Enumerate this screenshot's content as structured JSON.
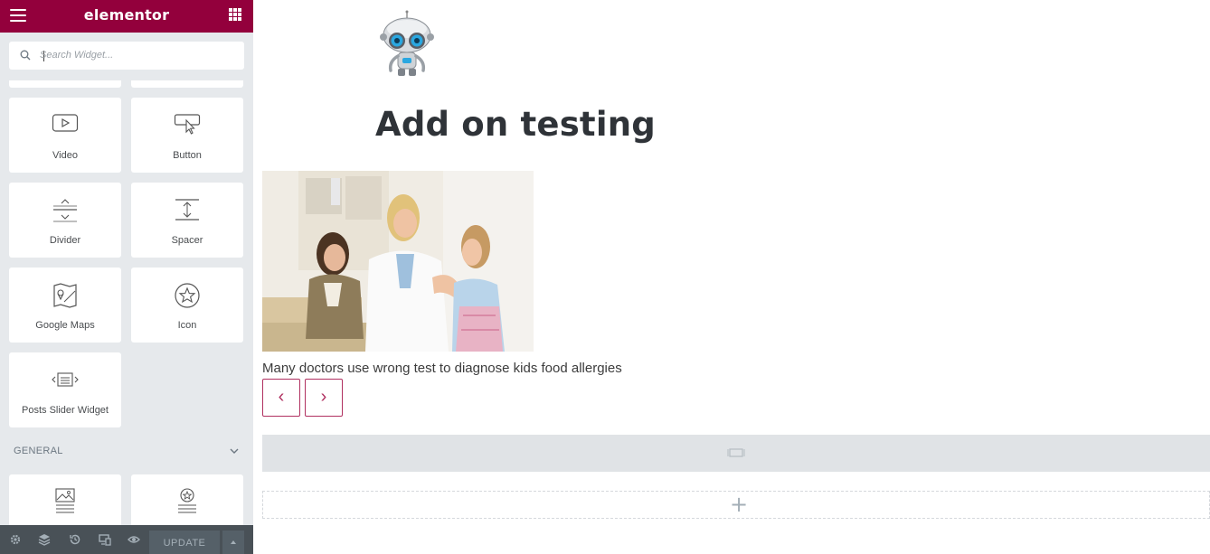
{
  "app": {
    "brand": "elementor"
  },
  "search": {
    "placeholder": "Search Widget..."
  },
  "widgets": [
    {
      "label": "Video",
      "icon": "video-icon"
    },
    {
      "label": "Button",
      "icon": "button-icon"
    },
    {
      "label": "Divider",
      "icon": "divider-icon"
    },
    {
      "label": "Spacer",
      "icon": "spacer-icon"
    },
    {
      "label": "Google Maps",
      "icon": "google-maps-icon"
    },
    {
      "label": "Icon",
      "icon": "star-circle-icon"
    },
    {
      "label": "Posts Slider Widget",
      "icon": "posts-slider-icon"
    }
  ],
  "section": {
    "title": "GENERAL"
  },
  "bottom": {
    "update_label": "UPDATE"
  },
  "page": {
    "heading": "Add on testing",
    "caption": "Many doctors use wrong test to diagnose kids food allergies",
    "prev": "‹",
    "next": "›",
    "add": "+"
  },
  "colors": {
    "brand": "#93003c",
    "sidebar_bg": "#e6e9ec",
    "accent": "#b03060"
  }
}
